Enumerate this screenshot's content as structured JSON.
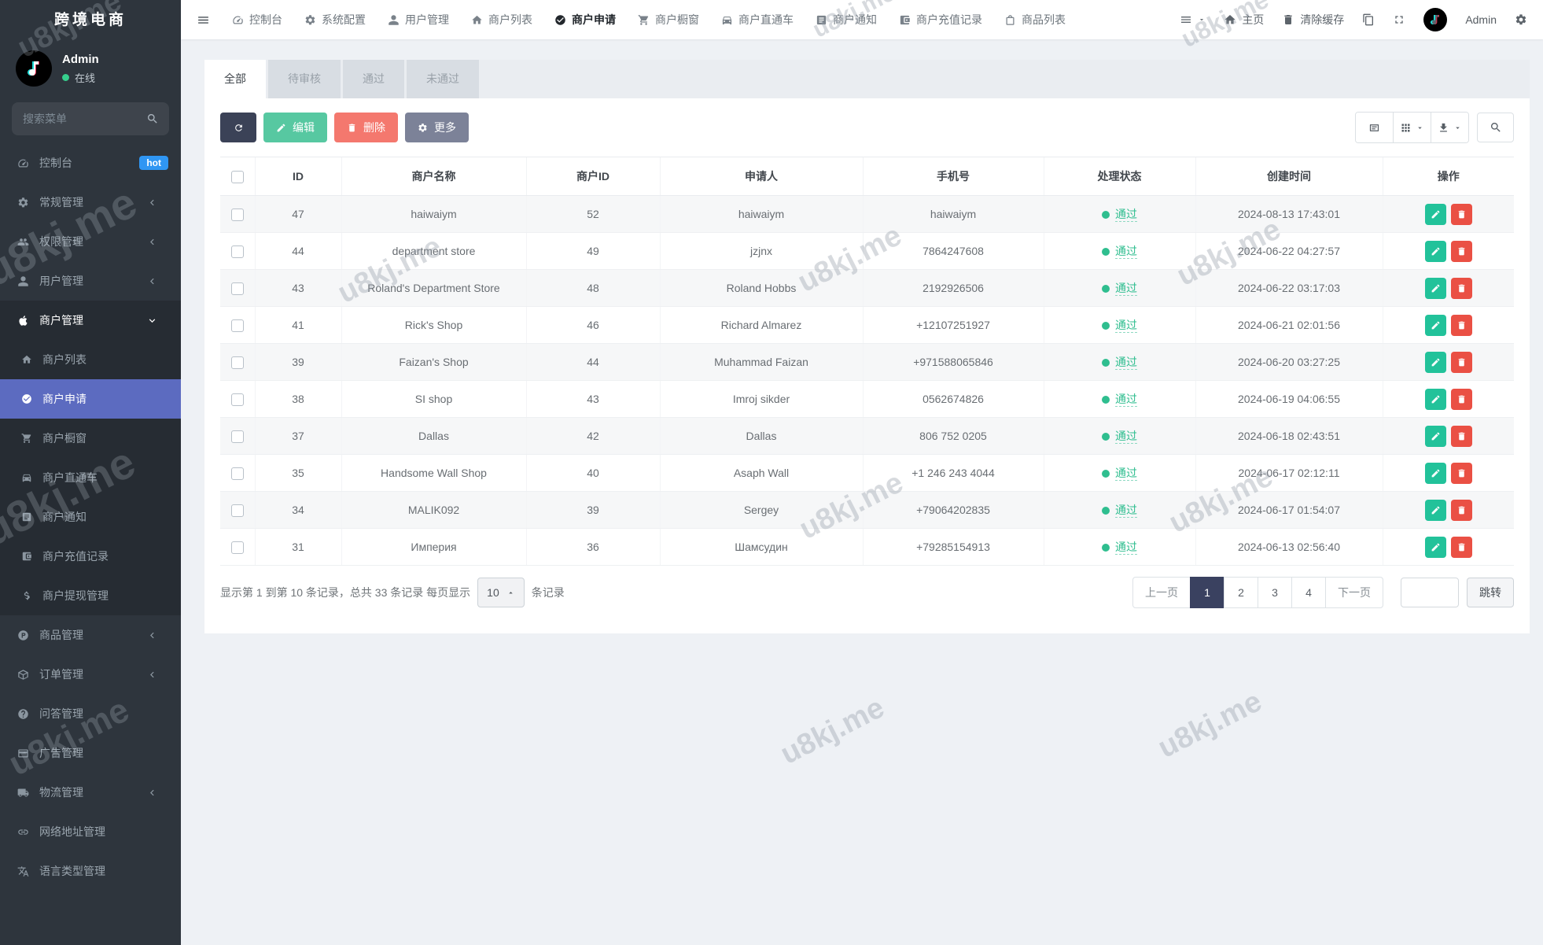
{
  "app": {
    "title": "跨境电商",
    "watermark": "u8kj.me"
  },
  "colors": {
    "sidebar_bg": "#2e353d",
    "active_menu": "#5c6bc0",
    "hot_badge": "#2f96f3",
    "online_dot": "#36cf8d",
    "refresh_btn": "#3b4257",
    "edit_btn": "#57c8a1",
    "delete_btn": "#f4786e",
    "more_btn": "#7c8298",
    "status_pass": "#2fbe8f",
    "row_edit_btn": "#22c29a",
    "row_delete_btn": "#ea5044",
    "pagination_active": "#3a4160"
  },
  "sidebar": {
    "user": {
      "name": "Admin",
      "status": "在线"
    },
    "search_placeholder": "搜索菜单",
    "menu": [
      {
        "label": "控制台",
        "icon": "dashboard",
        "badge": "hot"
      },
      {
        "label": "常规管理",
        "icon": "gear",
        "chevron": "left"
      },
      {
        "label": "权限管理",
        "icon": "users",
        "chevron": "left"
      },
      {
        "label": "用户管理",
        "icon": "user",
        "chevron": "left"
      },
      {
        "label": "商户管理",
        "icon": "apple",
        "chevron": "down",
        "expanded": true,
        "children": [
          {
            "label": "商户列表",
            "icon": "home"
          },
          {
            "label": "商户申请",
            "icon": "check",
            "active": true
          },
          {
            "label": "商户橱窗",
            "icon": "cart"
          },
          {
            "label": "商户直通车",
            "icon": "car"
          },
          {
            "label": "商户通知",
            "icon": "notice"
          },
          {
            "label": "商户充值记录",
            "icon": "recharge"
          },
          {
            "label": "商户提现管理",
            "icon": "dollar"
          }
        ]
      },
      {
        "label": "商品管理",
        "icon": "product",
        "chevron": "left"
      },
      {
        "label": "订单管理",
        "icon": "order",
        "chevron": "left"
      },
      {
        "label": "问答管理",
        "icon": "qa"
      },
      {
        "label": "广告管理",
        "icon": "ad"
      },
      {
        "label": "物流管理",
        "icon": "logistics",
        "chevron": "left"
      },
      {
        "label": "网络地址管理",
        "icon": "link"
      },
      {
        "label": "语言类型管理",
        "icon": "language"
      }
    ]
  },
  "topbar": {
    "nav": [
      {
        "label": "控制台",
        "icon": "dashboard"
      },
      {
        "label": "系统配置",
        "icon": "gear"
      },
      {
        "label": "用户管理",
        "icon": "user"
      },
      {
        "label": "商户列表",
        "icon": "home"
      },
      {
        "label": "商户申请",
        "icon": "check",
        "active": true
      },
      {
        "label": "商户橱窗",
        "icon": "cart"
      },
      {
        "label": "商户直通车",
        "icon": "car"
      },
      {
        "label": "商户通知",
        "icon": "notice"
      },
      {
        "label": "商户充值记录",
        "icon": "recharge"
      },
      {
        "label": "商品列表",
        "icon": "bag"
      }
    ],
    "right": {
      "home_label": "主页",
      "clear_cache_label": "清除缓存",
      "username": "Admin"
    }
  },
  "tabs": [
    {
      "label": "全部",
      "active": true
    },
    {
      "label": "待审核"
    },
    {
      "label": "通过"
    },
    {
      "label": "未通过"
    }
  ],
  "toolbar": {
    "edit_label": "编辑",
    "delete_label": "删除",
    "more_label": "更多"
  },
  "table": {
    "columns": [
      "ID",
      "商户名称",
      "商户ID",
      "申请人",
      "手机号",
      "处理状态",
      "创建时间",
      "操作"
    ],
    "rows": [
      {
        "id": "47",
        "name": "haiwaiym",
        "merchant_id": "52",
        "applicant": "haiwaiym",
        "phone": "haiwaiym",
        "status": "通过",
        "created": "2024-08-13 17:43:01"
      },
      {
        "id": "44",
        "name": "department store",
        "merchant_id": "49",
        "applicant": "jzjnx",
        "phone": "7864247608",
        "status": "通过",
        "created": "2024-06-22 04:27:57"
      },
      {
        "id": "43",
        "name": "Roland's Department Store",
        "merchant_id": "48",
        "applicant": "Roland Hobbs",
        "phone": "2192926506",
        "status": "通过",
        "created": "2024-06-22 03:17:03"
      },
      {
        "id": "41",
        "name": "Rick's Shop",
        "merchant_id": "46",
        "applicant": "Richard Almarez",
        "phone": "+12107251927",
        "status": "通过",
        "created": "2024-06-21 02:01:56"
      },
      {
        "id": "39",
        "name": "Faizan's Shop",
        "merchant_id": "44",
        "applicant": "Muhammad Faizan",
        "phone": "+971588065846",
        "status": "通过",
        "created": "2024-06-20 03:27:25"
      },
      {
        "id": "38",
        "name": "SI shop",
        "merchant_id": "43",
        "applicant": "Imroj sikder",
        "phone": "0562674826",
        "status": "通过",
        "created": "2024-06-19 04:06:55"
      },
      {
        "id": "37",
        "name": "Dallas",
        "merchant_id": "42",
        "applicant": "Dallas",
        "phone": "806 752 0205",
        "status": "通过",
        "created": "2024-06-18 02:43:51"
      },
      {
        "id": "35",
        "name": "Handsome Wall Shop",
        "merchant_id": "40",
        "applicant": "Asaph Wall",
        "phone": "+1 246 243 4044",
        "status": "通过",
        "created": "2024-06-17 02:12:11"
      },
      {
        "id": "34",
        "name": "MALIK092",
        "merchant_id": "39",
        "applicant": "Sergey",
        "phone": "+79064202835",
        "status": "通过",
        "created": "2024-06-17 01:54:07"
      },
      {
        "id": "31",
        "name": "Империя",
        "merchant_id": "36",
        "applicant": "Шамсудин",
        "phone": "+79285154913",
        "status": "通过",
        "created": "2024-06-13 02:56:40"
      }
    ]
  },
  "footer": {
    "summary_prefix": "显示第 1 到第 10 条记录，总共 33 条记录 每页显示",
    "page_size": "10",
    "summary_suffix": "条记录",
    "prev_label": "上一页",
    "next_label": "下一页",
    "pages": [
      "1",
      "2",
      "3",
      "4"
    ],
    "active_page": "1",
    "jump_label": "跳转"
  }
}
